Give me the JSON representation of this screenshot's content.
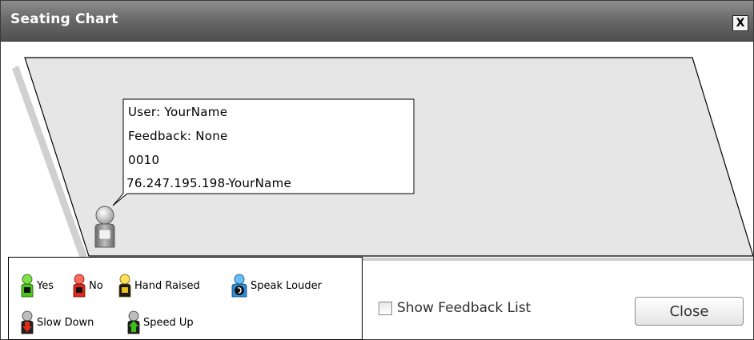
{
  "window": {
    "title": "Seating Chart",
    "close_glyph": "X"
  },
  "stage": {
    "seat_icon": "person-icon",
    "callout": {
      "user": "User: YourName",
      "feedback": "Feedback: None",
      "id": "0010",
      "address": "76.247.195.198-YourName"
    }
  },
  "legend": {
    "items": [
      {
        "label": "Yes",
        "icon": "person-green-icon",
        "color": "#4fc21c"
      },
      {
        "label": "No",
        "icon": "person-red-icon",
        "color": "#e02a1a"
      },
      {
        "label": "Hand Raised",
        "icon": "person-hand-raised-icon",
        "color": "#e8c21a"
      },
      {
        "label": "Speak Louder",
        "icon": "person-speak-louder-icon",
        "color": "#2e8fd8"
      },
      {
        "label": "Slow Down",
        "icon": "person-slow-down-icon",
        "color": "#e02a1a"
      },
      {
        "label": "Speed Up",
        "icon": "person-speed-up-icon",
        "color": "#3fbf1a"
      }
    ]
  },
  "controls": {
    "show_feedback_label": "Show Feedback List",
    "show_feedback_checked": false,
    "close_label": "Close"
  }
}
